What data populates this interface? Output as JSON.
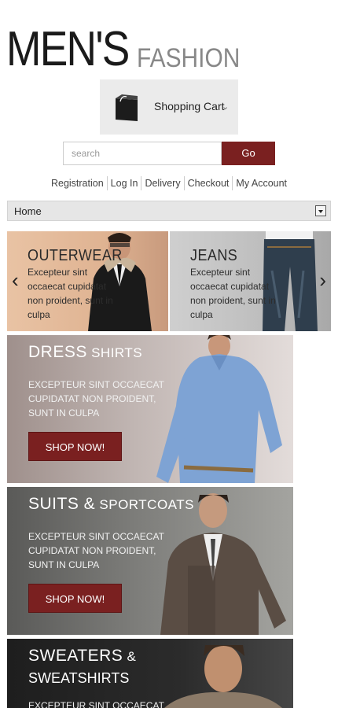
{
  "logo": {
    "main": "MEN'S",
    "sub": "FASHION"
  },
  "cart": {
    "label": "Shopping Cart"
  },
  "search": {
    "placeholder": "search",
    "button": "Go"
  },
  "top_links": [
    "Registration",
    "Log In",
    "Delivery",
    "Checkout",
    "My Account"
  ],
  "nav_select": {
    "selected": "Home"
  },
  "slider": {
    "slides": [
      {
        "title": "OUTERWEAR",
        "text": "Excepteur sint occaecat cupidatat non proident, sunt in culpa"
      },
      {
        "title": "JEANS",
        "text": "Excepteur sint occaecat cupidatat non proident, sunt in culpa"
      }
    ]
  },
  "banners": [
    {
      "title_big": "DRESS",
      "title_small": " SHIRTS",
      "text": "Excepteur sint occaecat cupidatat non proident, sunt in culpa",
      "button": "SHOP NOW!"
    },
    {
      "title_big": "SUITS &",
      "title_small": " SPORTCOATS",
      "text": "Excepteur sint occaecat cupidatat non proident, sunt in culpa",
      "button": "SHOP NOW!"
    },
    {
      "title_big": "SWEATERS",
      "title_small": " &",
      "title_line2": "SWEATSHIRTS",
      "text": "Excepteur sint occaecat"
    }
  ],
  "colors": {
    "accent": "#7a2020",
    "nav_bg": "#e6e6e6",
    "cart_bg": "#ebebeb"
  }
}
